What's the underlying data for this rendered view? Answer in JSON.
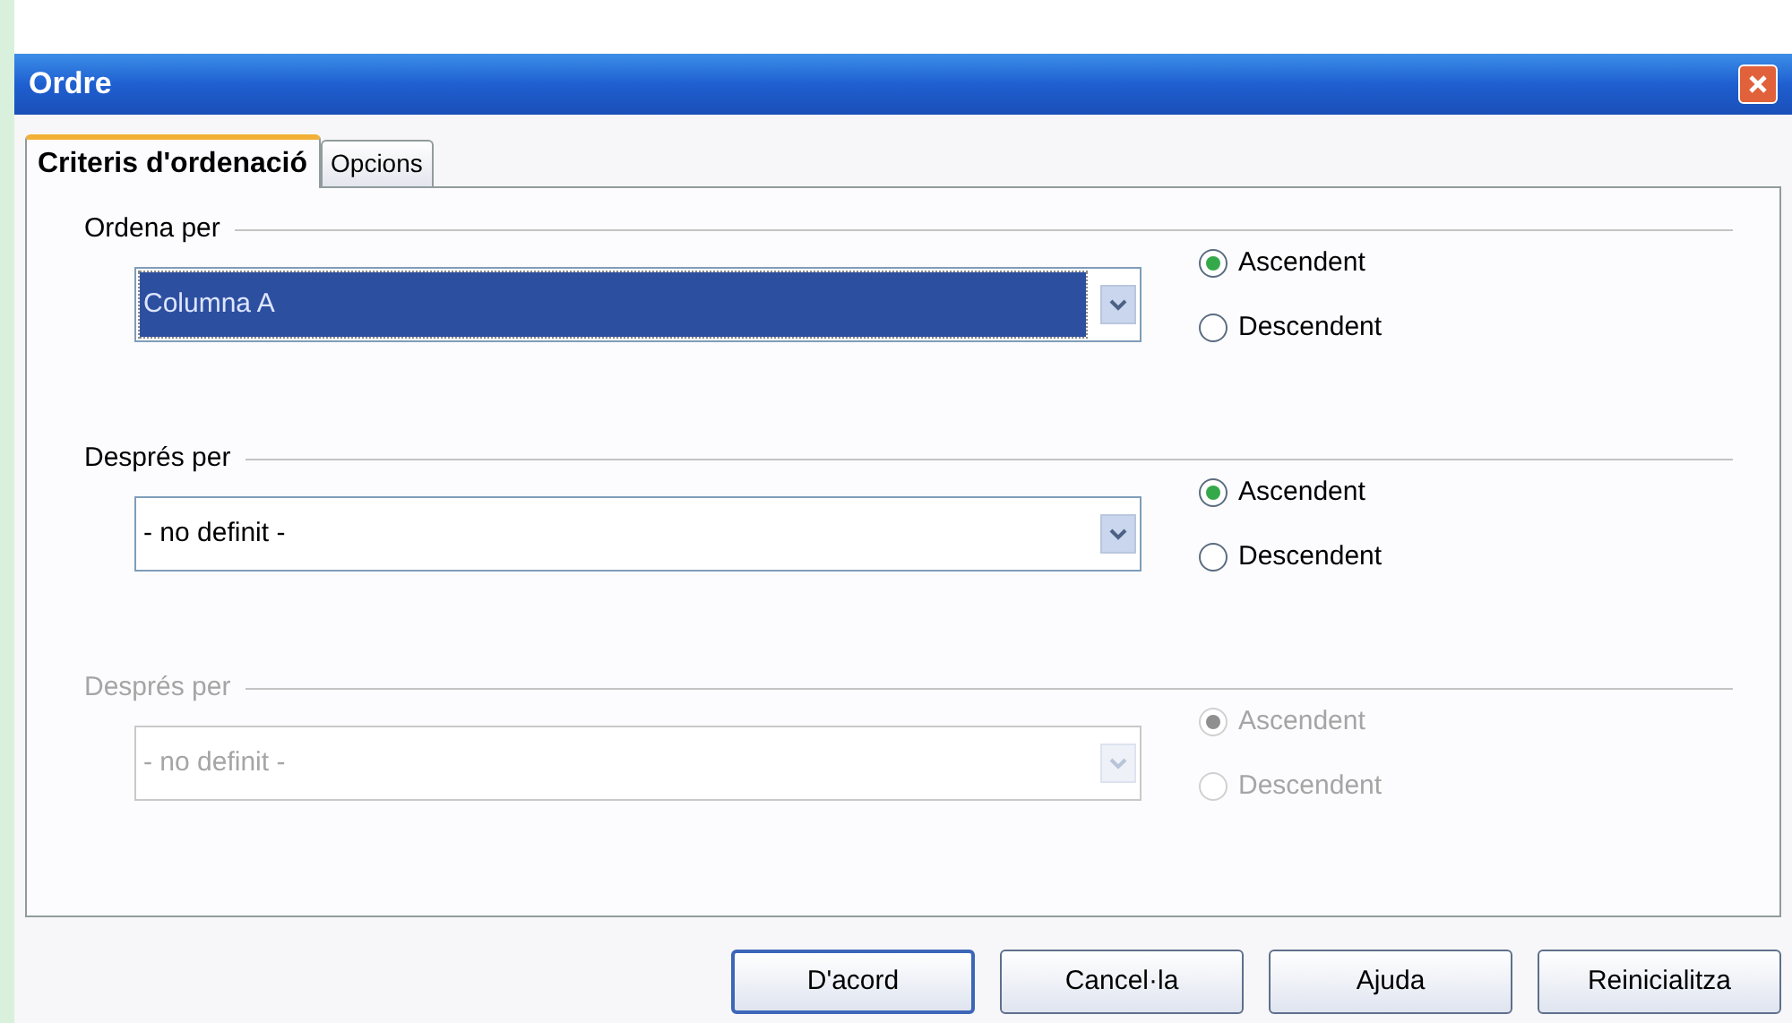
{
  "window": {
    "title": "Ordre"
  },
  "tabs": [
    {
      "label": "Criteris d'ordenació",
      "selected": true
    },
    {
      "label": "Opcions",
      "selected": false
    }
  ],
  "sections": [
    {
      "label": "Ordena per",
      "disabled": false,
      "combo": {
        "value": "Columna A",
        "focused": true
      },
      "options": [
        {
          "label": "Ascendent",
          "selected": true
        },
        {
          "label": "Descendent",
          "selected": false
        }
      ]
    },
    {
      "label": "Després per",
      "disabled": false,
      "combo": {
        "value": "- no definit -",
        "focused": false
      },
      "options": [
        {
          "label": "Ascendent",
          "selected": true
        },
        {
          "label": "Descendent",
          "selected": false
        }
      ]
    },
    {
      "label": "Després per",
      "disabled": true,
      "combo": {
        "value": "- no definit -",
        "focused": false
      },
      "options": [
        {
          "label": "Ascendent",
          "selected": true
        },
        {
          "label": "Descendent",
          "selected": false
        }
      ]
    }
  ],
  "buttons": [
    {
      "label": "D'acord",
      "default": true
    },
    {
      "label": "Cancel·la",
      "default": false
    },
    {
      "label": "Ajuda",
      "default": false
    },
    {
      "label": "Reinicialitza",
      "default": false
    }
  ]
}
